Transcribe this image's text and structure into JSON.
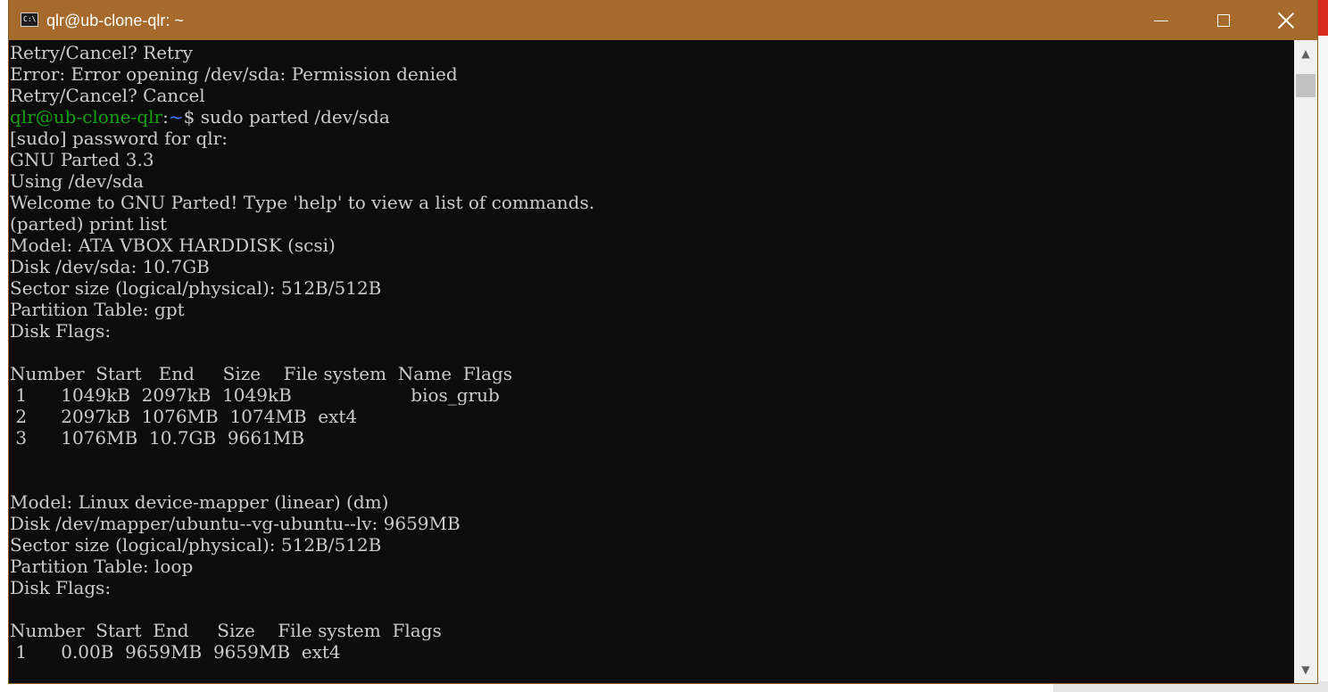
{
  "window": {
    "title": "qlr@ub-clone-qlr: ~",
    "icon": "console-icon",
    "accent_color": "#a56a2c",
    "controls": {
      "minimize": "minimize-icon",
      "maximize": "maximize-icon",
      "close": "close-icon"
    }
  },
  "terminal": {
    "background": "#0c0c0c",
    "foreground": "#cccccc",
    "prompt": {
      "user_host": "qlr@ub-clone-qlr",
      "colon": ":",
      "path": "~",
      "symbol": "$ ",
      "command": "sudo parted /dev/sda"
    },
    "lines": [
      "Retry/Cancel? Retry",
      "Error: Error opening /dev/sda: Permission denied",
      "Retry/Cancel? Cancel",
      "",
      "[sudo] password for qlr:",
      "GNU Parted 3.3",
      "Using /dev/sda",
      "Welcome to GNU Parted! Type 'help' to view a list of commands.",
      "(parted) print list",
      "Model: ATA VBOX HARDDISK (scsi)",
      "Disk /dev/sda: 10.7GB",
      "Sector size (logical/physical): 512B/512B",
      "Partition Table: gpt",
      "Disk Flags:",
      "",
      "Number  Start   End     Size    File system  Name  Flags",
      " 1      1049kB  2097kB  1049kB                     bios_grub",
      " 2      2097kB  1076MB  1074MB  ext4",
      " 3      1076MB  10.7GB  9661MB",
      "",
      "",
      "Model: Linux device-mapper (linear) (dm)",
      "Disk /dev/mapper/ubuntu--vg-ubuntu--lv: 9659MB",
      "Sector size (logical/physical): 512B/512B",
      "Partition Table: loop",
      "Disk Flags:",
      "",
      "Number  Start  End     Size    File system  Flags",
      " 1      0.00B  9659MB  9659MB  ext4"
    ]
  },
  "scrollbar": {
    "up": "▲",
    "down": "▼"
  }
}
